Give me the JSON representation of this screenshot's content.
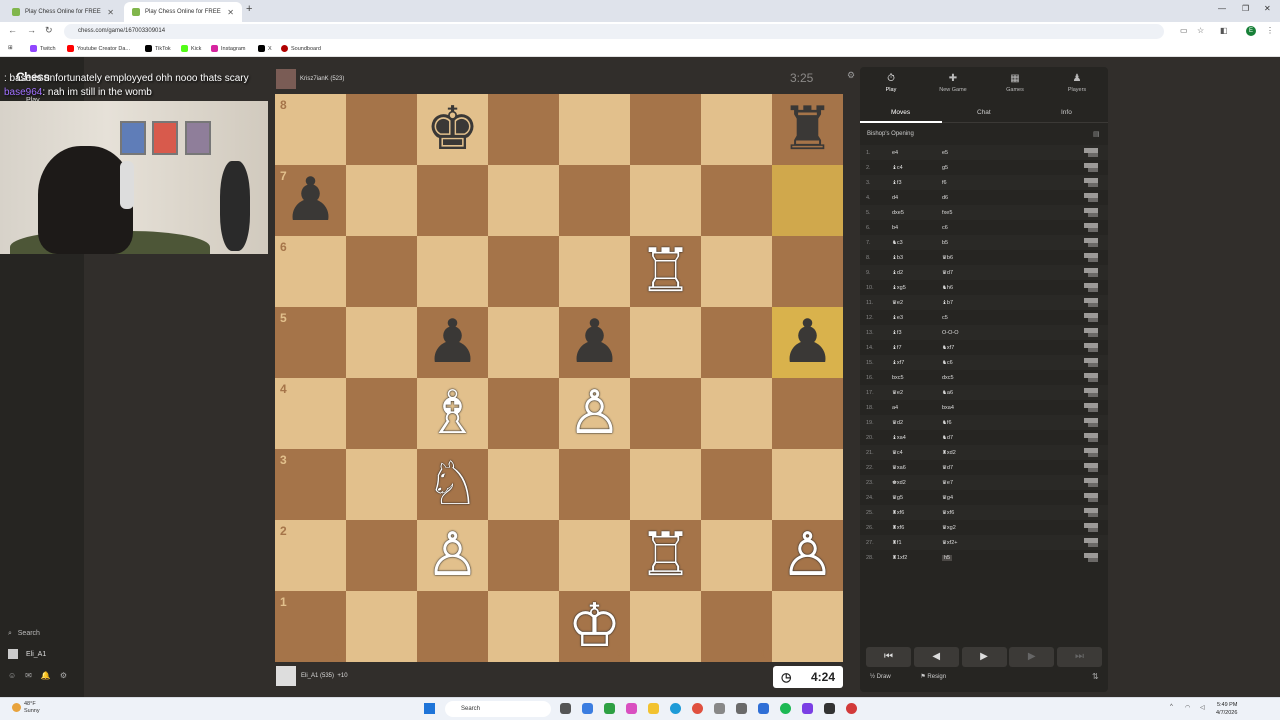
{
  "browser": {
    "tabs": [
      {
        "title": "Play Chess Online for FREE"
      },
      {
        "title": "Play Chess Online for FREE"
      }
    ],
    "url": "chess.com/game/167003309014",
    "bookmarks": [
      {
        "label": "Twitch",
        "color": "#9146ff"
      },
      {
        "label": "Youtube Creator Da...",
        "color": "#ff0000"
      },
      {
        "label": "TikTok",
        "color": "#000000"
      },
      {
        "label": "Kick",
        "color": "#53fc18"
      },
      {
        "label": "Instagram",
        "color": "#d6249f"
      },
      {
        "label": "X",
        "color": "#000000"
      },
      {
        "label": "Soundboard",
        "color": "#b00000"
      }
    ],
    "profile_initial": "E"
  },
  "sidebar": {
    "logo": "Chess",
    "play": "Play",
    "search": "Search",
    "username": "Eli_A1"
  },
  "stream_chat": [
    {
      "user": "",
      "text": ": base is unfortunately employyed ohh nooo thats scary"
    },
    {
      "user": "base964",
      "text": ": nah im still in the womb"
    }
  ],
  "game": {
    "top_player": "Krisz7ianK (523)",
    "top_clock": "3:25",
    "bottom_player": "Eli_A1 (535)",
    "bottom_extra": "+10",
    "bottom_clock": "4:24",
    "ranks": [
      "8",
      "7",
      "6",
      "5",
      "4",
      "3",
      "2",
      "1"
    ],
    "files": [
      "a",
      "b",
      "c",
      "d",
      "e",
      "f",
      "g",
      "h"
    ],
    "pieces": [
      {
        "square": "c8",
        "glyph": "♚",
        "color": "b"
      },
      {
        "square": "h8",
        "glyph": "♜",
        "color": "b"
      },
      {
        "square": "a7",
        "glyph": "♟",
        "color": "b"
      },
      {
        "square": "f6",
        "glyph": "♖",
        "color": "w"
      },
      {
        "square": "c5",
        "glyph": "♟",
        "color": "b"
      },
      {
        "square": "e5",
        "glyph": "♟",
        "color": "b"
      },
      {
        "square": "h5",
        "glyph": "♟",
        "color": "b"
      },
      {
        "square": "c4",
        "glyph": "♗",
        "color": "w"
      },
      {
        "square": "e4",
        "glyph": "♙",
        "color": "w"
      },
      {
        "square": "c3",
        "glyph": "♘",
        "color": "w"
      },
      {
        "square": "c2",
        "glyph": "♙",
        "color": "w"
      },
      {
        "square": "f2",
        "glyph": "♖",
        "color": "w"
      },
      {
        "square": "h2",
        "glyph": "♙",
        "color": "w"
      },
      {
        "square": "e1",
        "glyph": "♔",
        "color": "w"
      }
    ],
    "highlighted": [
      "h7",
      "h5"
    ]
  },
  "panel": {
    "tabs": [
      {
        "label": "Play",
        "icon": "⏱"
      },
      {
        "label": "New Game",
        "icon": "✚"
      },
      {
        "label": "Games",
        "icon": "▦"
      },
      {
        "label": "Players",
        "icon": "♟"
      }
    ],
    "subtabs": [
      "Moves",
      "Chat",
      "Info"
    ],
    "opening": "Bishop's Opening",
    "moves": [
      {
        "n": "1.",
        "w": "e4",
        "b": "e5"
      },
      {
        "n": "2.",
        "w": "♝c4",
        "b": "g5"
      },
      {
        "n": "3.",
        "w": "♝f3",
        "b": "f6"
      },
      {
        "n": "4.",
        "w": "d4",
        "b": "d6"
      },
      {
        "n": "5.",
        "w": "dxe5",
        "b": "fxe5"
      },
      {
        "n": "6.",
        "w": "b4",
        "b": "c6"
      },
      {
        "n": "7.",
        "w": "♞c3",
        "b": "b5"
      },
      {
        "n": "8.",
        "w": "♝b3",
        "b": "♛b6"
      },
      {
        "n": "9.",
        "w": "♝d2",
        "b": "♛d7"
      },
      {
        "n": "10.",
        "w": "♝xg5",
        "b": "♞h6"
      },
      {
        "n": "11.",
        "w": "♛e2",
        "b": "♝b7"
      },
      {
        "n": "12.",
        "w": "♝e3",
        "b": "c5"
      },
      {
        "n": "13.",
        "w": "♝f3",
        "b": "O-O-O"
      },
      {
        "n": "14.",
        "w": "♝f7",
        "b": "♞xf7"
      },
      {
        "n": "15.",
        "w": "♝xf7",
        "b": "♞c6"
      },
      {
        "n": "16.",
        "w": "bxc5",
        "b": "dxc5"
      },
      {
        "n": "17.",
        "w": "♛e2",
        "b": "♞a6"
      },
      {
        "n": "18.",
        "w": "a4",
        "b": "bxa4"
      },
      {
        "n": "19.",
        "w": "♛d2",
        "b": "♞f6"
      },
      {
        "n": "20.",
        "w": "♝xa4",
        "b": "♞d7"
      },
      {
        "n": "21.",
        "w": "♛c4",
        "b": "♜xd2"
      },
      {
        "n": "22.",
        "w": "♛xa6",
        "b": "♛d7"
      },
      {
        "n": "23.",
        "w": "♚xd2",
        "b": "♛e7"
      },
      {
        "n": "24.",
        "w": "♛g5",
        "b": "♛g4"
      },
      {
        "n": "25.",
        "w": "♜xf6",
        "b": "♛xf6"
      },
      {
        "n": "26.",
        "w": "♜xf6",
        "b": "♛xg2"
      },
      {
        "n": "27.",
        "w": "♜f1",
        "b": "♛xf2+"
      },
      {
        "n": "28.",
        "w": "♜1xf2",
        "b": "h5"
      }
    ],
    "controls": [
      "⏮",
      "◀",
      "▶",
      "▶",
      "⏭"
    ],
    "draw": "Draw",
    "resign": "Resign"
  },
  "taskbar": {
    "temp": "48°F",
    "weather": "Sunny",
    "search": "Search",
    "time": "5:49 PM",
    "date": "4/7/2026"
  }
}
